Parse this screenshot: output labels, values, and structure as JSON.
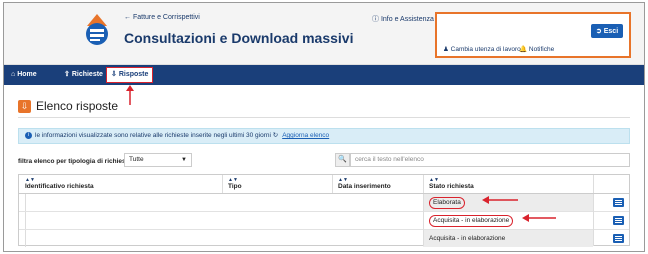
{
  "header": {
    "back_link": "Fatture e Corrispettivi",
    "app_title": "Consultazioni e Download massivi",
    "info_link": "Info e Assistenza",
    "logout_label": "Esci",
    "change_user_label": "Cambia utenza di lavoro",
    "notifications_label": "Notifiche"
  },
  "nav": {
    "items": [
      {
        "label": "Home",
        "icon": "home-icon"
      },
      {
        "label": "Richieste",
        "icon": "upload-icon"
      },
      {
        "label": "Risposte",
        "icon": "download-icon",
        "active": true
      }
    ]
  },
  "section": {
    "title": "Elenco risposte"
  },
  "info": {
    "text": "le informazioni visualizzate sono relative alle richieste inserite negli ultimi 30 giorni",
    "refresh_label": "Aggiorna elenco"
  },
  "filter": {
    "label": "filtra elenco per tipologia di richiesta",
    "selected": "Tutte",
    "search_placeholder": "cerca il testo nell'elenco"
  },
  "table": {
    "columns": [
      "Identificativo richiesta",
      "Tipo",
      "Data inserimento",
      "Stato richiesta"
    ],
    "rows": [
      {
        "stato": "Elaborata"
      },
      {
        "stato": "Acquisita - in elaborazione"
      },
      {
        "stato": "Acquisita - in elaborazione"
      }
    ]
  },
  "colors": {
    "nav_bg": "#1a3f7a",
    "accent": "#e8742a",
    "highlight": "#d9232d",
    "button": "#1a5fb4"
  }
}
